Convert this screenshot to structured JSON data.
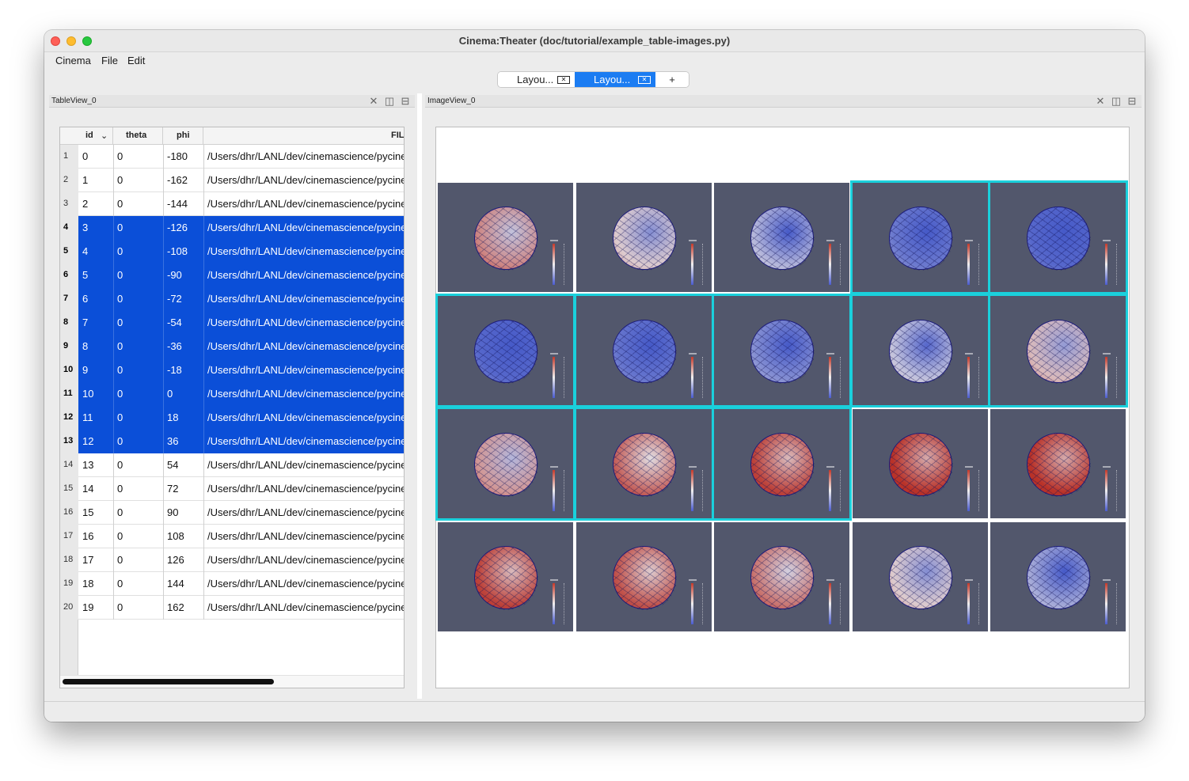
{
  "window": {
    "title": "Cinema:Theater (doc/tutorial/example_table-images.py)"
  },
  "menu": [
    "Cinema",
    "File",
    "Edit"
  ],
  "tabs": [
    {
      "label": "Layou...",
      "active": false
    },
    {
      "label": "Layou...",
      "active": true
    },
    {
      "label": "+",
      "active": false
    }
  ],
  "table_panel": {
    "title": "TableView_0",
    "columns": [
      "id",
      "theta",
      "phi",
      "FIL"
    ],
    "sort_indicator": "chevron-down-icon",
    "rows": [
      {
        "n": "1",
        "id": "0",
        "theta": "0",
        "phi": "-180",
        "file": "/Users/dhr/LANL/dev/cinemascience/pycinema",
        "selected": false
      },
      {
        "n": "2",
        "id": "1",
        "theta": "0",
        "phi": "-162",
        "file": "/Users/dhr/LANL/dev/cinemascience/pycinema",
        "selected": false
      },
      {
        "n": "3",
        "id": "2",
        "theta": "0",
        "phi": "-144",
        "file": "/Users/dhr/LANL/dev/cinemascience/pycinema",
        "selected": false
      },
      {
        "n": "4",
        "id": "3",
        "theta": "0",
        "phi": "-126",
        "file": "/Users/dhr/LANL/dev/cinemascience/pycinema",
        "selected": true
      },
      {
        "n": "5",
        "id": "4",
        "theta": "0",
        "phi": "-108",
        "file": "/Users/dhr/LANL/dev/cinemascience/pycinema",
        "selected": true
      },
      {
        "n": "6",
        "id": "5",
        "theta": "0",
        "phi": "-90",
        "file": "/Users/dhr/LANL/dev/cinemascience/pycinema",
        "selected": true
      },
      {
        "n": "7",
        "id": "6",
        "theta": "0",
        "phi": "-72",
        "file": "/Users/dhr/LANL/dev/cinemascience/pycinema",
        "selected": true
      },
      {
        "n": "8",
        "id": "7",
        "theta": "0",
        "phi": "-54",
        "file": "/Users/dhr/LANL/dev/cinemascience/pycinema",
        "selected": true
      },
      {
        "n": "9",
        "id": "8",
        "theta": "0",
        "phi": "-36",
        "file": "/Users/dhr/LANL/dev/cinemascience/pycinema",
        "selected": true
      },
      {
        "n": "10",
        "id": "9",
        "theta": "0",
        "phi": "-18",
        "file": "/Users/dhr/LANL/dev/cinemascience/pycinema",
        "selected": true
      },
      {
        "n": "11",
        "id": "10",
        "theta": "0",
        "phi": "0",
        "file": "/Users/dhr/LANL/dev/cinemascience/pycinema",
        "selected": true
      },
      {
        "n": "12",
        "id": "11",
        "theta": "0",
        "phi": "18",
        "file": "/Users/dhr/LANL/dev/cinemascience/pycinema",
        "selected": true
      },
      {
        "n": "13",
        "id": "12",
        "theta": "0",
        "phi": "36",
        "file": "/Users/dhr/LANL/dev/cinemascience/pycinema",
        "selected": true
      },
      {
        "n": "14",
        "id": "13",
        "theta": "0",
        "phi": "54",
        "file": "/Users/dhr/LANL/dev/cinemascience/pycinema",
        "selected": false
      },
      {
        "n": "15",
        "id": "14",
        "theta": "0",
        "phi": "72",
        "file": "/Users/dhr/LANL/dev/cinemascience/pycinema",
        "selected": false
      },
      {
        "n": "16",
        "id": "15",
        "theta": "0",
        "phi": "90",
        "file": "/Users/dhr/LANL/dev/cinemascience/pycinema",
        "selected": false
      },
      {
        "n": "17",
        "id": "16",
        "theta": "0",
        "phi": "108",
        "file": "/Users/dhr/LANL/dev/cinemascience/pycinema",
        "selected": false
      },
      {
        "n": "18",
        "id": "17",
        "theta": "0",
        "phi": "126",
        "file": "/Users/dhr/LANL/dev/cinemascience/pycinema",
        "selected": false
      },
      {
        "n": "19",
        "id": "18",
        "theta": "0",
        "phi": "144",
        "file": "/Users/dhr/LANL/dev/cinemascience/pycinema",
        "selected": false
      },
      {
        "n": "20",
        "id": "19",
        "theta": "0",
        "phi": "162",
        "file": "/Users/dhr/LANL/dev/cinemascience/pycinema",
        "selected": false
      }
    ]
  },
  "image_panel": {
    "title": "ImageView_0",
    "thumbnails": [
      {
        "id": "0",
        "selected": false,
        "hot": 0.75
      },
      {
        "id": "1",
        "selected": false,
        "hot": 0.55
      },
      {
        "id": "2",
        "selected": false,
        "hot": 0.35
      },
      {
        "id": "3",
        "selected": true,
        "hot": 0.12
      },
      {
        "id": "4",
        "selected": true,
        "hot": 0.05
      },
      {
        "id": "5",
        "selected": true,
        "hot": 0.05
      },
      {
        "id": "6",
        "selected": true,
        "hot": 0.1
      },
      {
        "id": "7",
        "selected": true,
        "hot": 0.2
      },
      {
        "id": "8",
        "selected": true,
        "hot": 0.4
      },
      {
        "id": "9",
        "selected": true,
        "hot": 0.6
      },
      {
        "id": "10",
        "selected": true,
        "hot": 0.7
      },
      {
        "id": "11",
        "selected": true,
        "hot": 0.85
      },
      {
        "id": "12",
        "selected": true,
        "hot": 0.95
      },
      {
        "id": "13",
        "selected": false,
        "hot": 1.0
      },
      {
        "id": "14",
        "selected": false,
        "hot": 1.0
      },
      {
        "id": "15",
        "selected": false,
        "hot": 0.95
      },
      {
        "id": "16",
        "selected": false,
        "hot": 0.9
      },
      {
        "id": "17",
        "selected": false,
        "hot": 0.8
      },
      {
        "id": "18",
        "selected": false,
        "hot": 0.55
      },
      {
        "id": "19",
        "selected": false,
        "hot": 0.3
      }
    ]
  },
  "colors": {
    "selection": "#0b4fd8",
    "highlight": "#1ad0dc",
    "accent": "#1b7cf2",
    "render_bg": "#52576c"
  }
}
